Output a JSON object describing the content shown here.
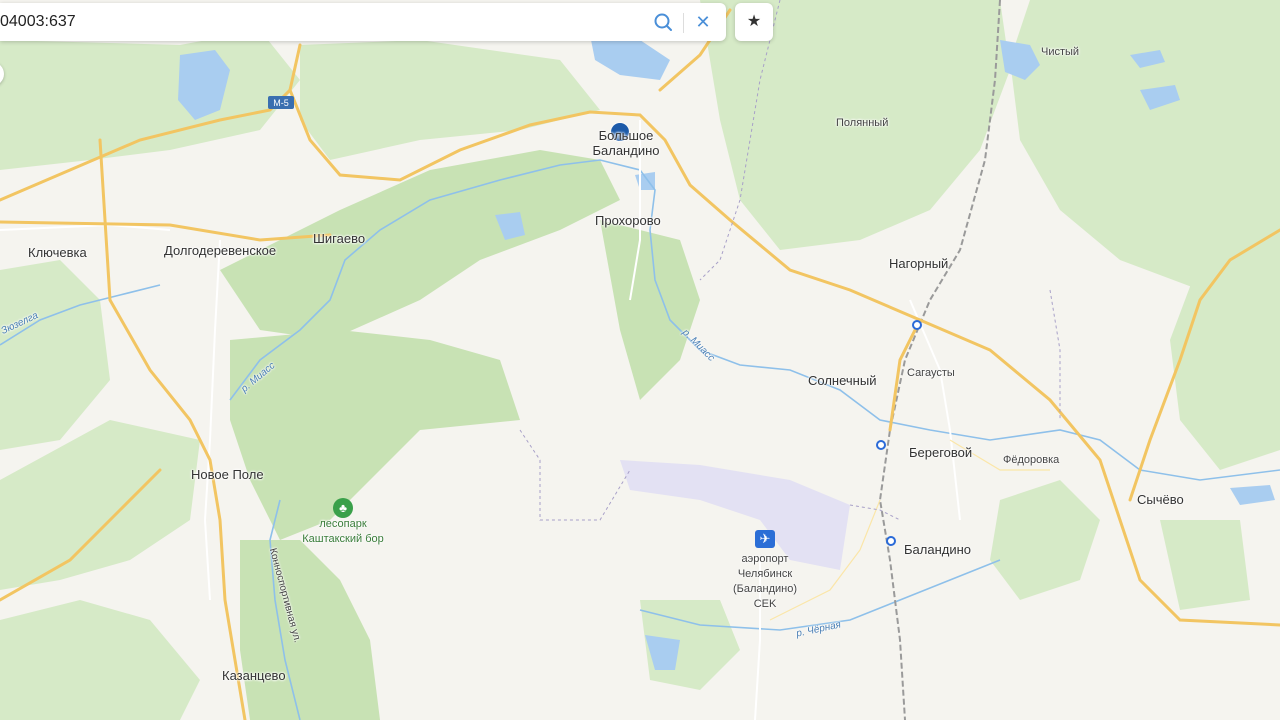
{
  "search": {
    "query": "04003:637"
  },
  "controls": {
    "bookmark_icon": "star-icon",
    "search_icon": "search-icon",
    "clear_icon": "close-icon"
  },
  "colors": {
    "marker": "#1c5aa8",
    "road": "#f2c562",
    "forest": "#d3e8c2",
    "water": "#a9cdf0",
    "airport_area": "#e3e1f3",
    "rail": "#9a9a9a"
  },
  "places": {
    "bolshoe_balandino": "Большое Баландино",
    "chistyi": "Чистый",
    "polyannyi": "Полянный",
    "prokhorovo": "Прохорово",
    "klyuchevka": "Ключевка",
    "dolgoderevenskoe": "Долгодеревенское",
    "shigaevo": "Шигаево",
    "nagornyi": "Нагорный",
    "solnechnyi": "Солнечный",
    "sagausty": "Сагаусты",
    "beregovoi": "Береговой",
    "fedorovka": "Фёдоровка",
    "sychevo": "Сычёво",
    "novoe_pole": "Новое Поле",
    "balandino": "Баландино",
    "kazantsevo": "Казанцево"
  },
  "poi": {
    "park": "лесопарк Каштакский бор",
    "airport": "аэропорт Челябинск (Баландино) CEK"
  },
  "roads": {
    "m5": "М-5"
  },
  "rivers": {
    "miass_1": "р. Миасс",
    "miass_2": "р. Миасс",
    "chernaya": "р. Чёрная",
    "uzelga": "Зюзелга"
  },
  "streets": {
    "konnosportivnaya": "Конноспортивная ул."
  }
}
